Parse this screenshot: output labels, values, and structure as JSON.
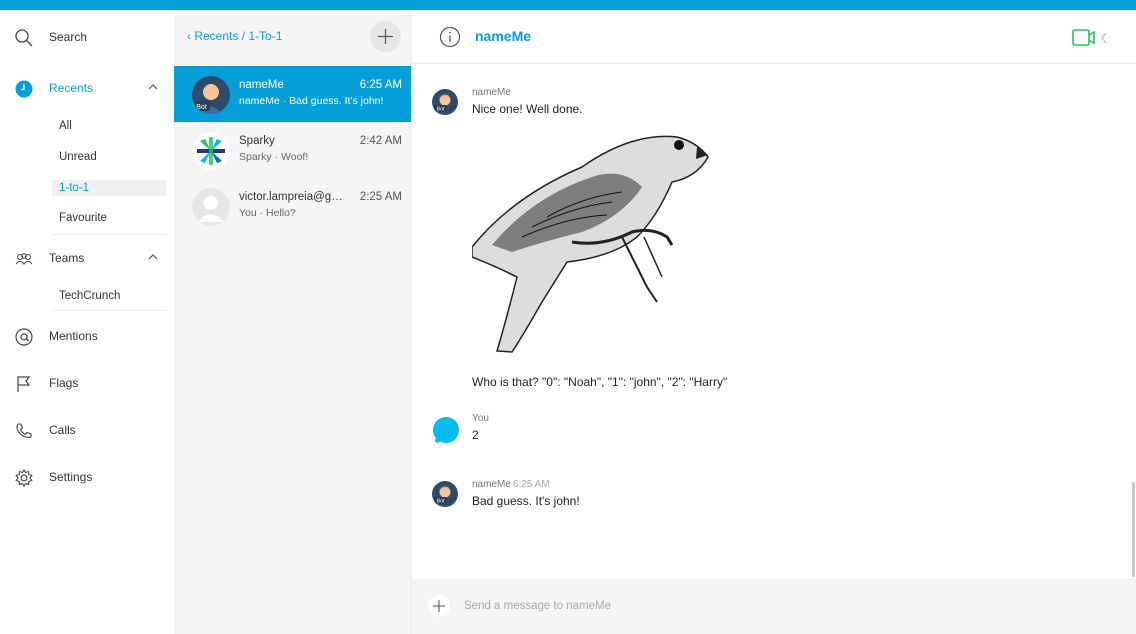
{
  "nav": {
    "search_label": "Search",
    "recents_label": "Recents",
    "recents_sub": [
      "All",
      "Unread",
      "1-to-1",
      "Favourite"
    ],
    "teams_label": "Teams",
    "teams_sub": [
      "TechCrunch"
    ],
    "mentions_label": "Mentions",
    "flags_label": "Flags",
    "calls_label": "Calls",
    "settings_label": "Settings"
  },
  "list": {
    "breadcrumb": "Recents / 1-To-1",
    "conversations": [
      {
        "name": "nameMe",
        "time": "6:25 AM",
        "preview": "nameMe · Bad guess. It's john!",
        "badge": "Bot"
      },
      {
        "name": "Sparky",
        "time": "2:42 AM",
        "preview": "Sparky · Woof!"
      },
      {
        "name": "victor.lampreia@gm...",
        "time": "2:25 AM",
        "preview": "You · Hello?"
      }
    ]
  },
  "chat": {
    "title": "nameMe",
    "messages": [
      {
        "sender": "nameMe",
        "time": "",
        "text": "Nice one! Well done.",
        "badge": "Bot"
      },
      {
        "caption": "Who is that? \"0\": \"Noah\", \"1\": \"john\", \"2\": \"Harry\""
      },
      {
        "sender": "You",
        "text": "2"
      },
      {
        "sender": "nameMe",
        "time": "6:25 AM",
        "text": "Bad guess. It's john!",
        "badge": "Bot"
      }
    ],
    "composer_placeholder": "Send a message to nameMe"
  },
  "colors": {
    "accent": "#049fd9",
    "video": "#22c55e"
  }
}
